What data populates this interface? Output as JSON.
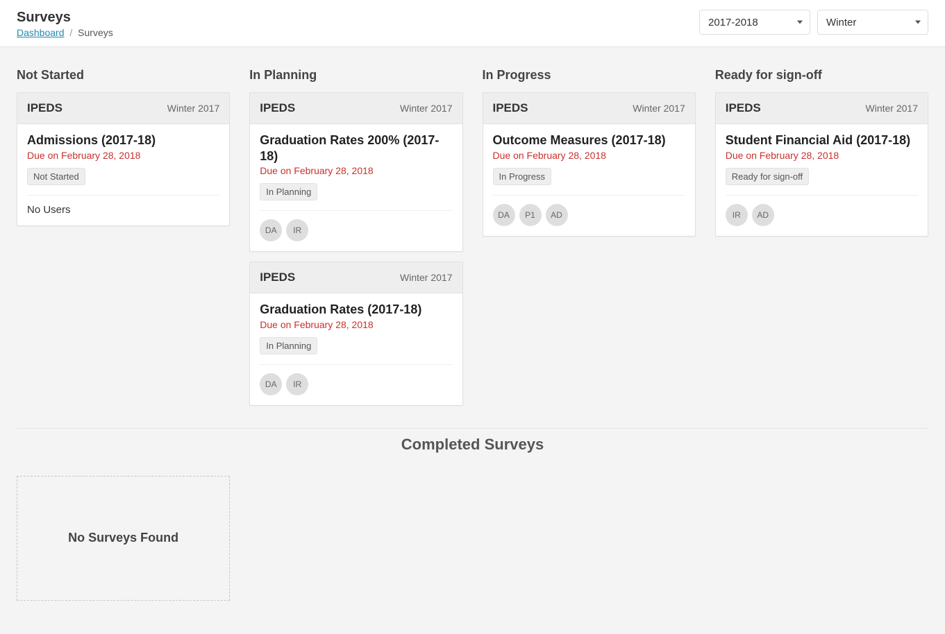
{
  "header": {
    "title": "Surveys",
    "breadcrumb": {
      "link_label": "Dashboard",
      "current": "Surveys"
    },
    "year_selector": "2017-2018",
    "season_selector": "Winter"
  },
  "columns": [
    {
      "title": "Not Started",
      "cards": [
        {
          "category": "IPEDS",
          "term": "Winter 2017",
          "title": "Admissions (2017-18)",
          "due": "Due on February 28, 2018",
          "status": "Not Started",
          "no_users_label": "No Users",
          "avatars": []
        }
      ]
    },
    {
      "title": "In Planning",
      "cards": [
        {
          "category": "IPEDS",
          "term": "Winter 2017",
          "title": "Graduation Rates 200% (2017-18)",
          "due": "Due on February 28, 2018",
          "status": "In Planning",
          "avatars": [
            "DA",
            "IR"
          ]
        },
        {
          "category": "IPEDS",
          "term": "Winter 2017",
          "title": "Graduation Rates (2017-18)",
          "due": "Due on February 28, 2018",
          "status": "In Planning",
          "avatars": [
            "DA",
            "IR"
          ]
        }
      ]
    },
    {
      "title": "In Progress",
      "cards": [
        {
          "category": "IPEDS",
          "term": "Winter 2017",
          "title": "Outcome Measures (2017-18)",
          "due": "Due on February 28, 2018",
          "status": "In Progress",
          "avatars": [
            "DA",
            "P1",
            "AD"
          ]
        }
      ]
    },
    {
      "title": "Ready for sign-off",
      "cards": [
        {
          "category": "IPEDS",
          "term": "Winter 2017",
          "title": "Student Financial Aid (2017-18)",
          "due": "Due on February 28, 2018",
          "status": "Ready for sign-off",
          "avatars": [
            "IR",
            "AD"
          ]
        }
      ]
    }
  ],
  "completed": {
    "heading": "Completed Surveys",
    "empty_label": "No Surveys Found"
  }
}
